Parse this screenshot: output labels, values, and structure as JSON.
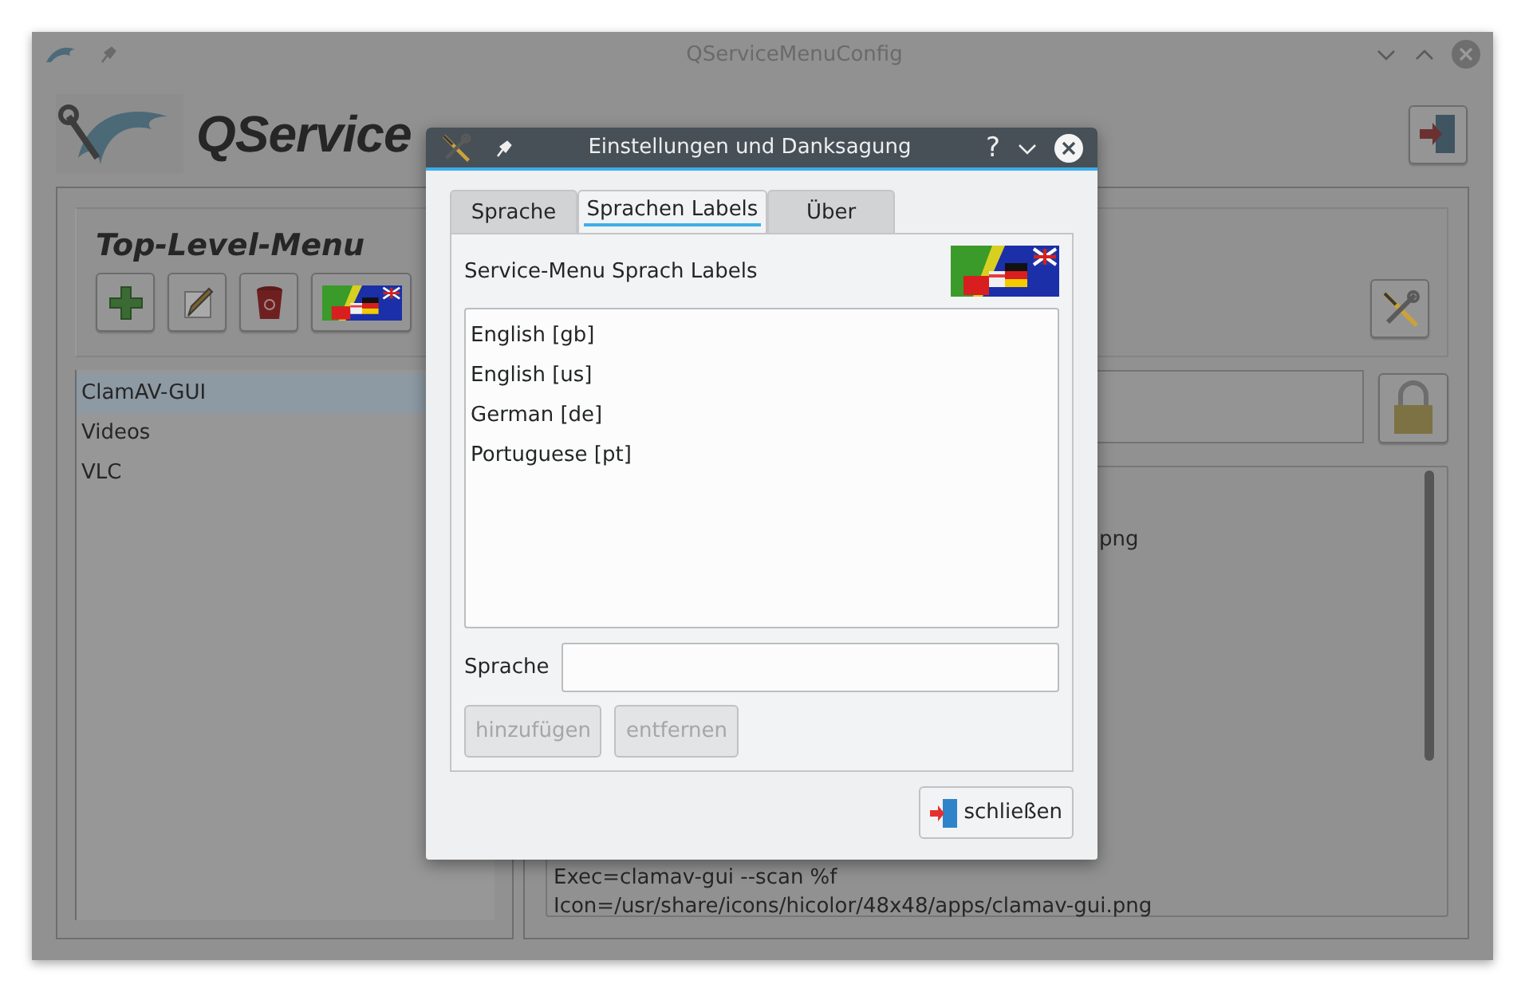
{
  "main_window": {
    "title": "QServiceMenuConfig",
    "header_title": "QService",
    "group_title": "Top-Level-Menu",
    "menu_items": [
      {
        "label": "ClamAV-GUI",
        "selected": true
      },
      {
        "label": "Videos",
        "selected": false
      },
      {
        "label": "VLC",
        "selected": false
      }
    ],
    "editor": {
      "fragment": "png",
      "lines": [
        "Exec=clamav-gui --scan %f",
        "Icon=/usr/share/icons/hicolor/48x48/apps/clamav-gui.png"
      ]
    }
  },
  "dialog": {
    "title": "Einstellungen und Danksagung",
    "help": "?",
    "tabs": [
      {
        "label": "Sprache",
        "selected": false
      },
      {
        "label": "Sprachen Labels",
        "selected": true
      },
      {
        "label": "Über",
        "selected": false
      }
    ],
    "heading": "Service-Menu Sprach Labels",
    "languages": [
      "English [gb]",
      "English [us]",
      "German [de]",
      "Portuguese [pt]"
    ],
    "field": {
      "label": "Sprache"
    },
    "buttons": [
      {
        "label": "hinzufügen",
        "disabled": true
      },
      {
        "label": "entfernen",
        "disabled": true
      }
    ],
    "close_button": "schließen"
  }
}
